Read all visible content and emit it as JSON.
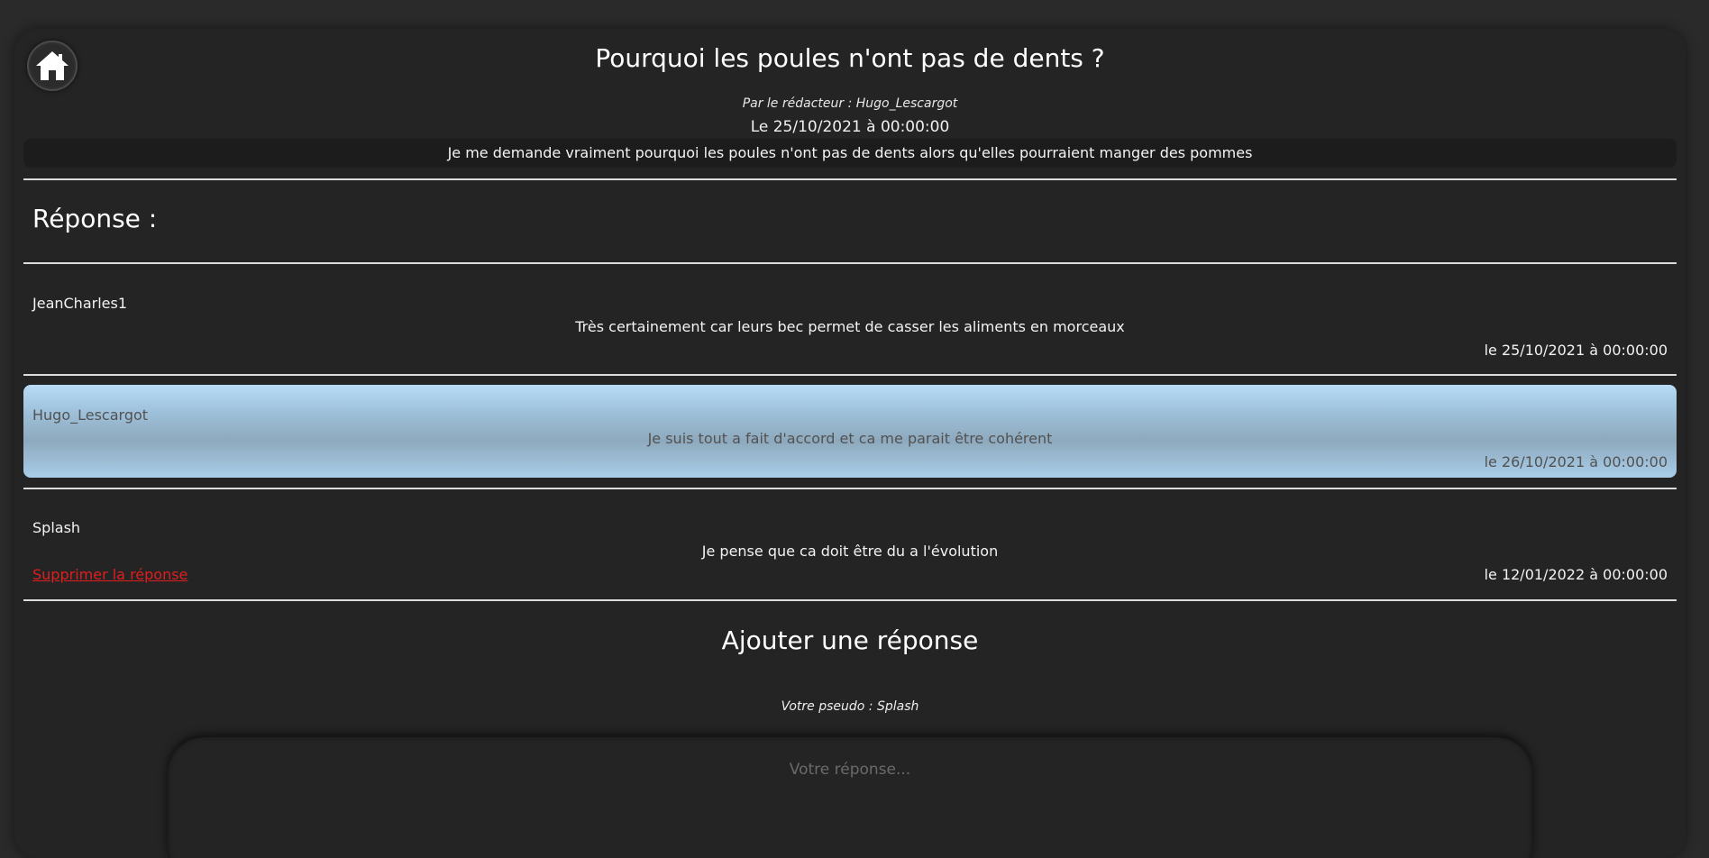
{
  "question": {
    "title": "Pourquoi les poules n'ont pas de dents ?",
    "author_line": "Par le rédacteur : Hugo_Lescargot",
    "date_line": "Le 25/10/2021 à 00:00:00",
    "body": "Je me demande vraiment pourquoi les poules n'ont pas de dents alors qu'elles pourraient manger des pommes"
  },
  "nav": {
    "home_icon": "home-icon"
  },
  "responses": {
    "heading": "Réponse :",
    "items": [
      {
        "pseudo": "JeanCharles1",
        "text": "Très certainement car leurs bec permet de casser les aliments en morceaux",
        "date": "le 25/10/2021 à 00:00:00"
      },
      {
        "pseudo": "Hugo_Lescargot",
        "text": "Je suis tout a fait d'accord et ca me parait être cohérent",
        "date": "le 26/10/2021 à 00:00:00",
        "highlighted": true
      },
      {
        "pseudo": "Splash",
        "text": "Je pense que ca doit être du a l'évolution",
        "date": "le 12/01/2022 à 00:00:00",
        "delete_label": "Supprimer la réponse"
      }
    ]
  },
  "add_response": {
    "title": "Ajouter une réponse",
    "pseudo_line": "Votre pseudo : Splash",
    "placeholder": "Votre réponse..."
  },
  "colors": {
    "background": "#2a2a2a",
    "panel": "#242424",
    "highlight_start": "#b8dcf6",
    "highlight_mid": "#8ea9bd",
    "delete_link": "#e01e1e"
  }
}
